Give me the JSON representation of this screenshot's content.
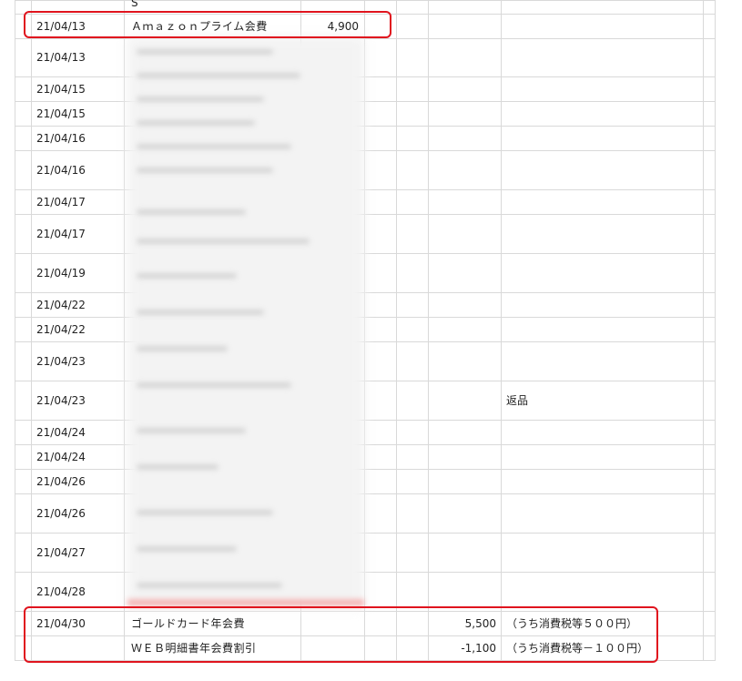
{
  "rows": [
    {
      "date": "",
      "desc": "S",
      "amount": "",
      "total": "",
      "note": ""
    },
    {
      "date": "21/04/13",
      "desc": "Ａｍａｚｏｎプライム会費",
      "amount": "4,900",
      "total": "",
      "note": ""
    },
    {
      "date": "21/04/13",
      "desc": "",
      "amount": "",
      "total": "",
      "note": ""
    },
    {
      "date": "21/04/15",
      "desc": "",
      "amount": "",
      "total": "",
      "note": ""
    },
    {
      "date": "21/04/15",
      "desc": "",
      "amount": "",
      "total": "",
      "note": ""
    },
    {
      "date": "21/04/16",
      "desc": "",
      "amount": "",
      "total": "",
      "note": ""
    },
    {
      "date": "21/04/16",
      "desc": "",
      "amount": "",
      "total": "",
      "note": ""
    },
    {
      "date": "21/04/17",
      "desc": "",
      "amount": "",
      "total": "",
      "note": ""
    },
    {
      "date": "21/04/17",
      "desc": "",
      "amount": "",
      "total": "",
      "note": ""
    },
    {
      "date": "21/04/19",
      "desc": "",
      "amount": "",
      "total": "",
      "note": ""
    },
    {
      "date": "21/04/22",
      "desc": "",
      "amount": "",
      "total": "",
      "note": ""
    },
    {
      "date": "21/04/22",
      "desc": "",
      "amount": "",
      "total": "",
      "note": ""
    },
    {
      "date": "21/04/23",
      "desc": "",
      "amount": "",
      "total": "",
      "note": ""
    },
    {
      "date": "21/04/23",
      "desc": "",
      "amount": "",
      "total": "",
      "note": "返品"
    },
    {
      "date": "21/04/24",
      "desc": "",
      "amount": "",
      "total": "",
      "note": ""
    },
    {
      "date": "21/04/24",
      "desc": "",
      "amount": "",
      "total": "",
      "note": ""
    },
    {
      "date": "21/04/26",
      "desc": "",
      "amount": "",
      "total": "",
      "note": ""
    },
    {
      "date": "21/04/26",
      "desc": "",
      "amount": "",
      "total": "",
      "note": ""
    },
    {
      "date": "21/04/27",
      "desc": "",
      "amount": "",
      "total": "",
      "note": ""
    },
    {
      "date": "21/04/28",
      "desc": "",
      "amount": "",
      "total": "",
      "note": ""
    },
    {
      "date": "21/04/30",
      "desc": "ゴールドカード年会費",
      "amount": "",
      "total": "5,500",
      "note": "（うち消費税等５００円）"
    },
    {
      "date": "",
      "desc": "ＷＥＢ明細書年会費割引",
      "amount": "",
      "total": "-1,100",
      "note": "（うち消費税等－１００円）"
    }
  ],
  "highlight_color": "#e0141e"
}
